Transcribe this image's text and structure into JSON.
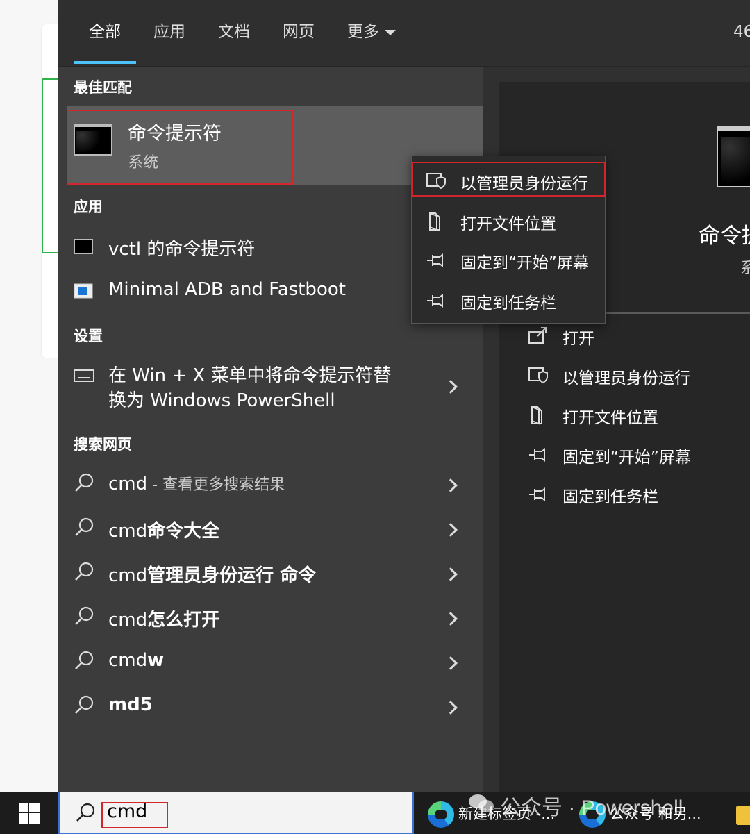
{
  "tabs": {
    "all": "全部",
    "apps": "应用",
    "docs": "文档",
    "web": "网页",
    "more": "更多",
    "count": "46"
  },
  "sections": {
    "best_match": "最佳匹配",
    "apps": "应用",
    "settings": "设置",
    "web_search": "搜索网页"
  },
  "best_match": {
    "title": "命令提示符",
    "subtitle": "系统"
  },
  "apps": [
    {
      "label": "vctl 的命令提示符",
      "icon": "terminal-icon"
    },
    {
      "label": "Minimal ADB and Fastboot",
      "icon": "app-window-icon"
    }
  ],
  "settings_item": {
    "line1": "在 Win + X 菜单中将命令提示符替",
    "line2": "换为 Windows PowerShell"
  },
  "web_results": [
    {
      "prefix": "cmd",
      "bold": "",
      "dim": " - 查看更多搜索结果"
    },
    {
      "prefix": "cmd",
      "bold": "命令大全",
      "dim": ""
    },
    {
      "prefix": "cmd",
      "bold": "管理员身份运行 命令",
      "dim": ""
    },
    {
      "prefix": "cmd",
      "bold": "怎么打开",
      "dim": ""
    },
    {
      "prefix": "cmd",
      "bold": "w",
      "dim": ""
    },
    {
      "prefix": "",
      "bold": "md5",
      "dim": ""
    }
  ],
  "context_menu": [
    {
      "label": "以管理员身份运行",
      "icon": "shield-icon"
    },
    {
      "label": "打开文件位置",
      "icon": "folder-open-icon"
    },
    {
      "label": "固定到“开始”屏幕",
      "icon": "pin-icon"
    },
    {
      "label": "固定到任务栏",
      "icon": "pin-icon"
    }
  ],
  "preview": {
    "title": "命令提",
    "subtitle": "系",
    "actions": [
      {
        "label": "打开",
        "icon": "open-icon"
      },
      {
        "label": "以管理员身份运行",
        "icon": "shield-icon"
      },
      {
        "label": "打开文件位置",
        "icon": "folder-open-icon"
      },
      {
        "label": "固定到“开始”屏幕",
        "icon": "pin-icon"
      },
      {
        "label": "固定到任务栏",
        "icon": "pin-icon"
      }
    ]
  },
  "taskbar": {
    "search_value": "cmd",
    "app1": "新建标签页 -...",
    "app2": "公众号 和另..."
  },
  "watermark": "公众号 · Powershell",
  "colors": {
    "accent": "#4cc2ff",
    "highlight_red": "#d0262c",
    "panel_bg": "#3c3c3c",
    "selection_bg": "#5d5d5d"
  }
}
